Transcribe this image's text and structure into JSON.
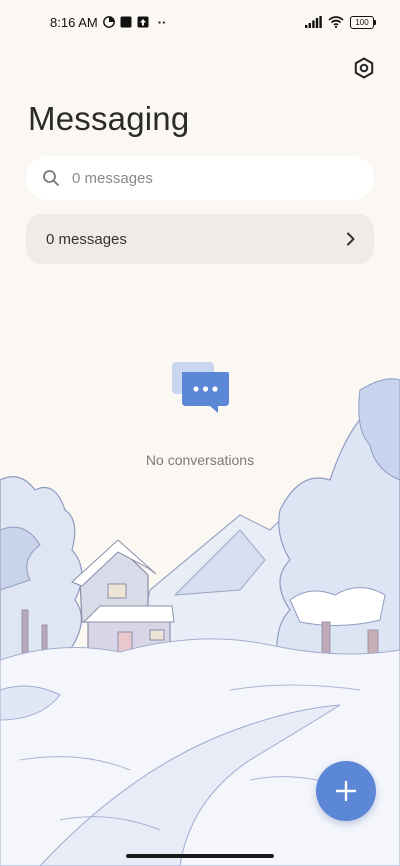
{
  "status_bar": {
    "time": "8:16 AM",
    "more": "··",
    "battery": "100"
  },
  "page": {
    "title": "Messaging"
  },
  "search": {
    "placeholder": "0 messages"
  },
  "messages_row": {
    "label": "0 messages"
  },
  "empty_state": {
    "text": "No conversations"
  },
  "colors": {
    "accent": "#5c86d6",
    "background": "#fbf7f3",
    "chat_icon": "#5c86d6"
  },
  "icons": {
    "settings": "hexagon-gear-icon",
    "search": "search-icon",
    "chevron": "chevron-right-icon",
    "fab": "plus-icon",
    "empty": "chat-bubbles-icon"
  }
}
